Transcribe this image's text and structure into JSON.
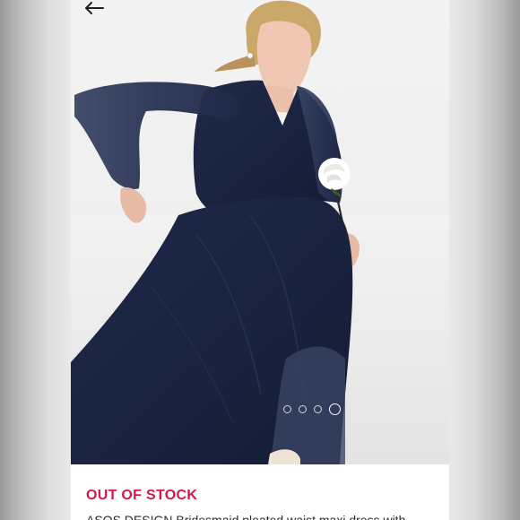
{
  "header": {
    "back_icon": "arrow-left-icon"
  },
  "gallery": {
    "image_count": 4,
    "active_index": 3,
    "inactive_dot_color": "#d6d6d6",
    "active_dot_color": "#ffffff"
  },
  "product": {
    "stock_status": "OUT OF STOCK",
    "stock_status_color": "#d2194a",
    "title_partial": "ASOS DESIGN Bridesmaid pleated waist maxi dress with"
  }
}
